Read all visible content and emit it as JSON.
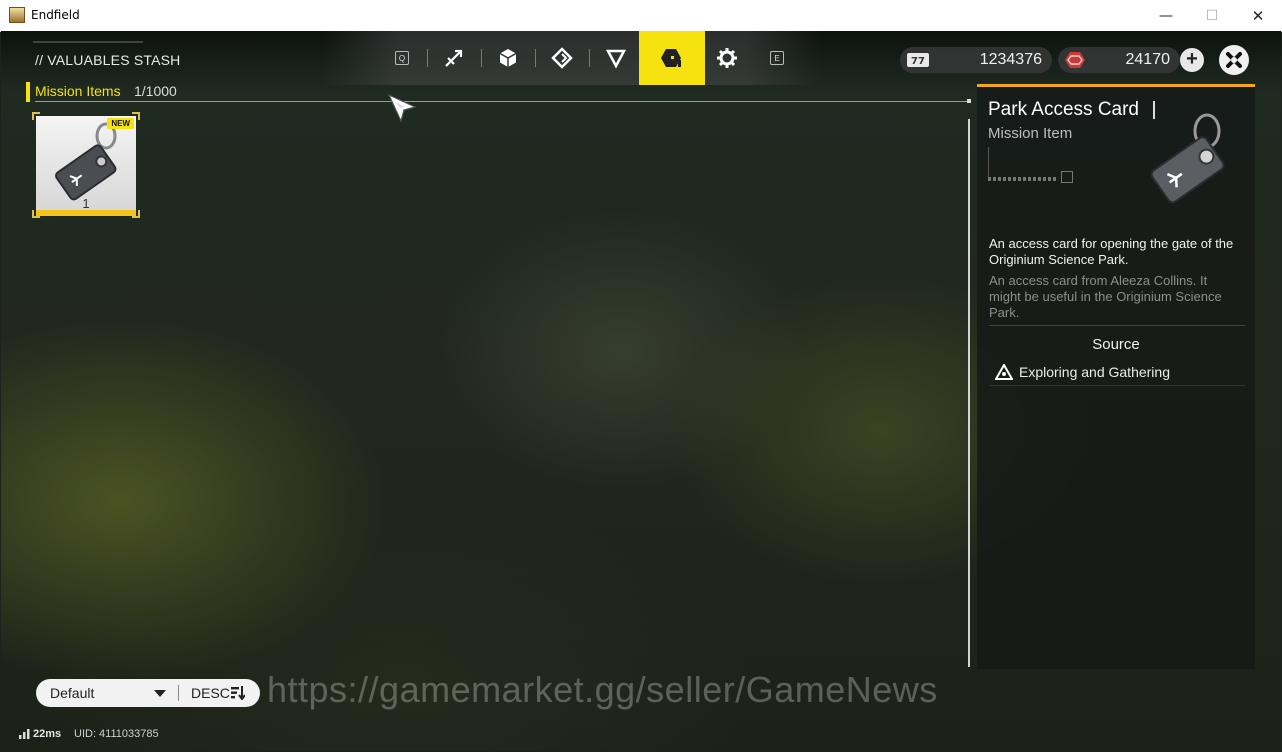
{
  "window": {
    "title": "Endfield"
  },
  "page": {
    "title": "// VALUABLES STASH"
  },
  "tabs": {
    "prev_key": "Q",
    "next_key": "E",
    "items": [
      {
        "icon": "weapon-icon"
      },
      {
        "icon": "cube-icon"
      },
      {
        "icon": "diamond-icon"
      },
      {
        "icon": "triangle-icon"
      },
      {
        "icon": "mission-items-icon",
        "active": true
      },
      {
        "icon": "gear-icon"
      }
    ]
  },
  "currency": {
    "first": {
      "icon": "ticket-icon",
      "value": "1234376"
    },
    "second": {
      "icon": "originium-icon",
      "value": "24170"
    },
    "add_label": "+"
  },
  "category": {
    "label": "Mission Items",
    "count": "1/1000"
  },
  "items": [
    {
      "name": "Park Access Card",
      "quantity": "1",
      "badge": "NEW"
    }
  ],
  "detail": {
    "name": "Park Access Card",
    "type": "Mission Item",
    "description": "An access card for opening the gate of the Originium Science Park.",
    "lore": "An access card from Aleeza Collins. It might be useful in the Originium Science Park.",
    "source_header": "Source",
    "source_item": "Exploring and Gathering"
  },
  "sort": {
    "default_label": "Default",
    "order_label": "DESC"
  },
  "status": {
    "ping": "22ms",
    "uid": "UID: 4111033785"
  },
  "watermark": "https://gamemarket.gg/seller/GameNews",
  "colors": {
    "accent": "#f5e20f",
    "panel_top": "#f5a61a"
  }
}
